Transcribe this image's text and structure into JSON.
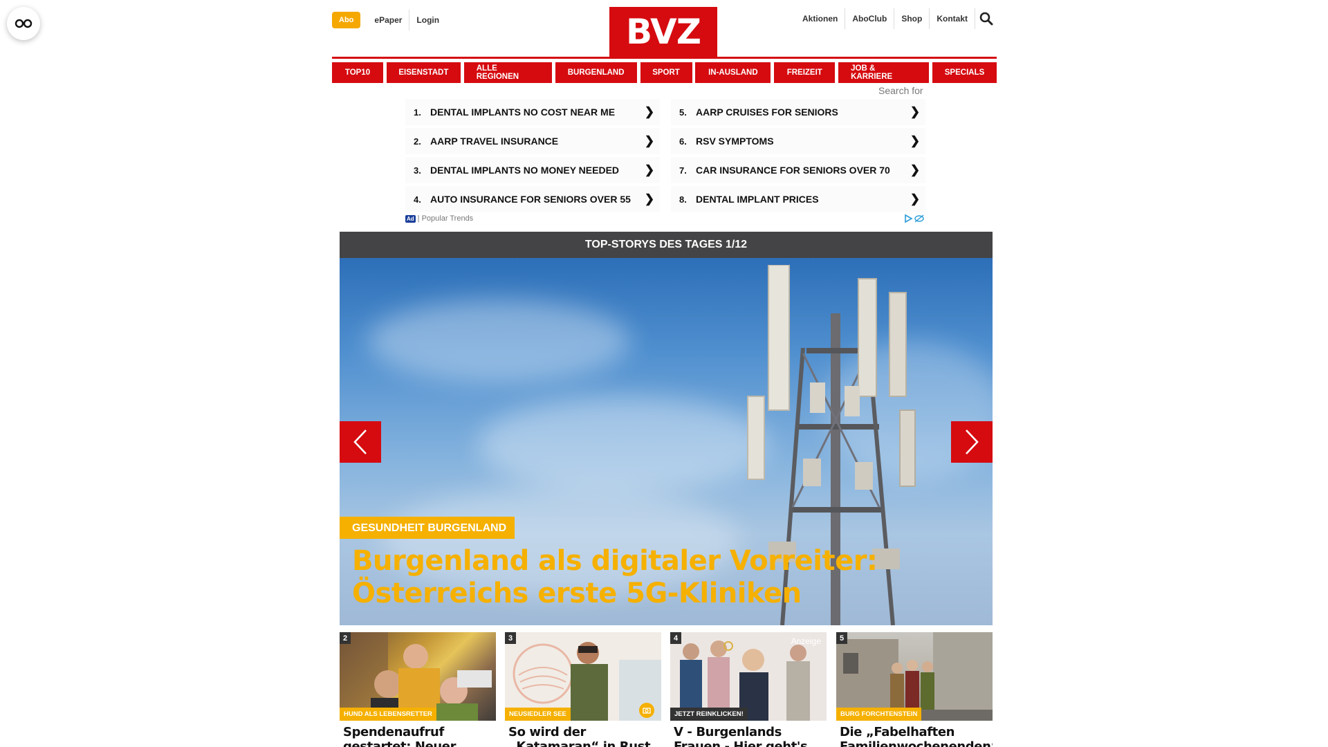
{
  "header": {
    "abo_label": "Abo",
    "left_links": [
      "ePaper",
      "Login"
    ],
    "logo": "BVZ",
    "right_links": [
      "Aktionen",
      "AboClub",
      "Shop",
      "Kontakt"
    ]
  },
  "nav": {
    "items": [
      "TOP10",
      "EISENSTADT",
      "ALLE REGIONEN",
      "BURGENLAND",
      "SPORT",
      "IN-AUSLAND",
      "FREIZEIT",
      "JOB & KARRIERE",
      "SPECIALS"
    ]
  },
  "ad": {
    "search_for": "Search for",
    "left": [
      {
        "num": "1.",
        "text": "DENTAL IMPLANTS NO COST NEAR ME"
      },
      {
        "num": "2.",
        "text": "AARP TRAVEL INSURANCE"
      },
      {
        "num": "3.",
        "text": "DENTAL IMPLANTS NO MONEY NEEDED"
      },
      {
        "num": "4.",
        "text": "AUTO INSURANCE FOR SENIORS OVER 55"
      }
    ],
    "right": [
      {
        "num": "5.",
        "text": "AARP CRUISES FOR SENIORS"
      },
      {
        "num": "6.",
        "text": "RSV SYMPTOMS"
      },
      {
        "num": "7.",
        "text": "CAR INSURANCE FOR SENIORS OVER 70"
      },
      {
        "num": "8.",
        "text": "DENTAL IMPLANT PRICES"
      }
    ],
    "arrow": "❯",
    "badge": "Ad",
    "footer": "| Popular Trends"
  },
  "hero": {
    "heading": "TOP-STORYS DES TAGES 1/12",
    "category": "GESUNDHEIT BURGENLAND",
    "title": "Burgenland als digitaler Vorreiter: Österreichs erste 5G-Kliniken"
  },
  "cards": [
    {
      "num": "2",
      "category": "HUND ALS LEBENSRETTER",
      "title": "Spendenaufruf gestartet: Neuer",
      "dark": false,
      "anzeige": ""
    },
    {
      "num": "3",
      "category": "NEUSIEDLER SEE",
      "title": "So wird der „Katamaran“ in Rust zum „Niki am",
      "dark": false,
      "anzeige": ""
    },
    {
      "num": "4",
      "category": "JETZT REINKLICKEN!",
      "title": "V - Burgenlands Frauen - Hier geht's zum Channel!",
      "dark": true,
      "anzeige": "Anzeige"
    },
    {
      "num": "5",
      "category": "BURG FORCHTENSTEIN",
      "title": "Die „Fabelhaften Familienwochenenden“",
      "dark": false,
      "anzeige": ""
    }
  ],
  "colors": {
    "brand_red": "#d50b10",
    "accent_yellow": "#f5b000",
    "abo_orange": "#f5a800"
  }
}
